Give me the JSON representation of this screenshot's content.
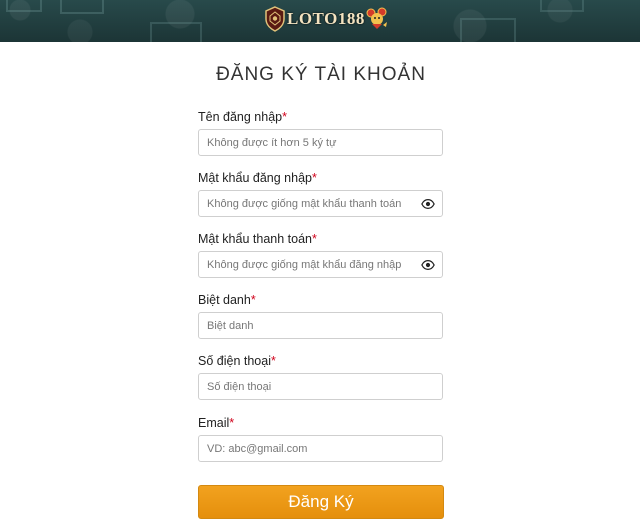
{
  "header": {
    "logo_text": "LOTO188"
  },
  "form": {
    "title": "ĐĂNG KÝ TÀI KHOẢN",
    "required_mark": "*",
    "fields": [
      {
        "label": "Tên đăng nhập",
        "placeholder": "Không được ít hơn 5 ký tự",
        "value": "",
        "has_eye_icon": false
      },
      {
        "label": "Mật khẩu đăng nhập",
        "placeholder": "Không được giống mật khẩu thanh toán",
        "value": "",
        "has_eye_icon": true
      },
      {
        "label": "Mật khẩu thanh toán",
        "placeholder": "Không được giống mật khẩu đăng nhập",
        "value": "",
        "has_eye_icon": true
      },
      {
        "label": "Biệt danh",
        "placeholder": "Biệt danh",
        "value": "",
        "has_eye_icon": false
      },
      {
        "label": "Số điện thoại",
        "placeholder": "Số điện thoại",
        "value": "",
        "has_eye_icon": false
      },
      {
        "label": "Email",
        "placeholder": "VD: abc@gmail.com",
        "value": "",
        "has_eye_icon": false
      }
    ],
    "submit_label": "Đăng Ký"
  },
  "colors": {
    "header_bg": "#1f3b3c",
    "required": "#d0021b",
    "button": "#ef9b19",
    "input_border": "#cfcfcf"
  },
  "icons": {
    "eye": "eye-icon"
  }
}
